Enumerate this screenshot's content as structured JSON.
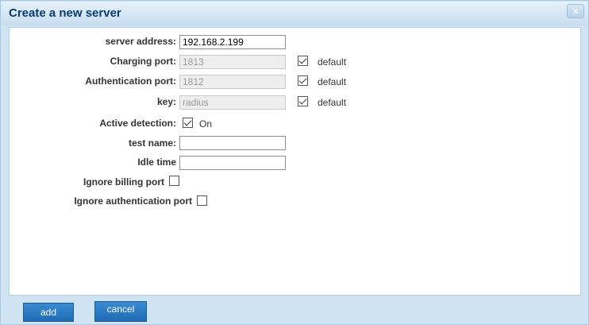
{
  "dialog": {
    "title": "Create a new server",
    "close_label": "×"
  },
  "form": {
    "server_address": {
      "label": "server address:",
      "value": "192.168.2.199"
    },
    "charging_port": {
      "label": "Charging port:",
      "value": "1813",
      "default_label": "default",
      "default_checked": true
    },
    "auth_port": {
      "label": "Authentication port:",
      "value": "1812",
      "default_label": "default",
      "default_checked": true
    },
    "key": {
      "label": "key:",
      "value": "radius",
      "default_label": "default",
      "default_checked": true
    },
    "active_detection": {
      "label": "Active detection:",
      "option_label": "On",
      "checked": true
    },
    "test_name": {
      "label": "test name:",
      "value": ""
    },
    "idle_time": {
      "label": "Idle time",
      "value": ""
    },
    "ignore_billing": {
      "label": "Ignore billing port",
      "checked": false
    },
    "ignore_auth": {
      "label": "Ignore authentication port",
      "checked": false
    }
  },
  "buttons": {
    "add": "add",
    "cancel": "cancel"
  }
}
